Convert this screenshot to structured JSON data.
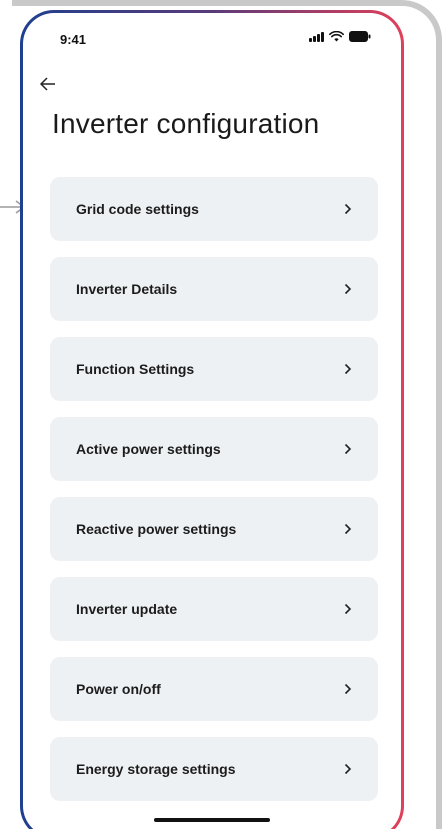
{
  "status_bar": {
    "time": "9:41",
    "icons": [
      "signal-icon",
      "wifi-icon",
      "battery-icon"
    ]
  },
  "header": {
    "back_icon": "arrow-left-icon",
    "title": "Inverter configuration"
  },
  "menu": {
    "items": [
      {
        "label": "Grid code settings"
      },
      {
        "label": "Inverter Details"
      },
      {
        "label": "Function Settings"
      },
      {
        "label": "Active power settings"
      },
      {
        "label": "Reactive power settings"
      },
      {
        "label": "Inverter update"
      },
      {
        "label": "Power on/off"
      },
      {
        "label": "Energy storage settings"
      }
    ],
    "item_icon": "chevron-right-icon"
  },
  "colors": {
    "border_gradient_start": "#1f3f8f",
    "border_gradient_end": "#e0405a",
    "item_background": "#eef1f4",
    "pointer": "#9a9a9a"
  }
}
